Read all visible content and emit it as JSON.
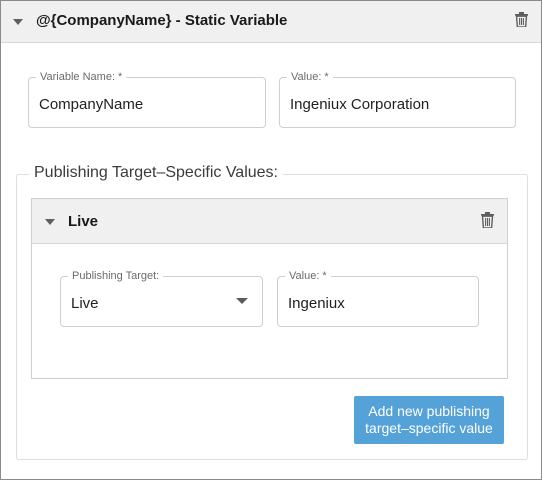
{
  "variable": {
    "header_title": "@{CompanyName} - Static Variable",
    "name_label": "Variable Name: *",
    "name_value": "CompanyName",
    "value_label": "Value: *",
    "value_value": "Ingeniux Corporation"
  },
  "publishing_group": {
    "legend": "Publishing Target–Specific Values:",
    "targets": [
      {
        "title": "Live",
        "target_label": "Publishing Target:",
        "target_selected": "Live",
        "value_label": "Value: *",
        "value_value": "Ingeniux"
      }
    ],
    "add_button_label": "Add new publishing target–specific value"
  },
  "colors": {
    "header_bg": "#f0f0f0",
    "button_bg": "#55a2d8",
    "icon": "#5f5f5f"
  },
  "icons": {
    "collapse": "chevron-down-icon",
    "delete": "trash-icon"
  }
}
